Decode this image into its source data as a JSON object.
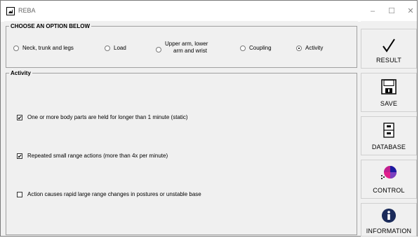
{
  "window": {
    "title": "REBA",
    "minimize": "–",
    "maximize": "☐",
    "close": "✕"
  },
  "options": {
    "legend": "CHOOSE AN OPTION BELOW",
    "items": [
      {
        "label": "Neck, trunk and legs",
        "selected": false
      },
      {
        "label": "Load",
        "selected": false
      },
      {
        "label_line1": "Upper arm, lower",
        "label_line2": "arm and wrist",
        "selected": false
      },
      {
        "label": "Coupling",
        "selected": false
      },
      {
        "label": "Activity",
        "selected": true
      }
    ]
  },
  "activity": {
    "legend": "Activity",
    "items": [
      {
        "label": "One or more body parts are held for longer than 1 minute (static)",
        "checked": true
      },
      {
        "label": "Repeated small range actions (more than 4x per minute)",
        "checked": true
      },
      {
        "label": "Action causes rapid large range changes in postures or unstable base",
        "checked": false
      }
    ]
  },
  "toolbar": {
    "result": {
      "label": "RESULT",
      "icon": "checkmark-icon"
    },
    "save": {
      "label": "SAVE",
      "icon": "floppy-icon"
    },
    "database": {
      "label": "DATABASE",
      "icon": "cabinet-icon"
    },
    "control": {
      "label": "CONTROL",
      "icon": "pie-chart-icon"
    },
    "information": {
      "label": "INFORMATION",
      "icon": "info-icon"
    }
  }
}
